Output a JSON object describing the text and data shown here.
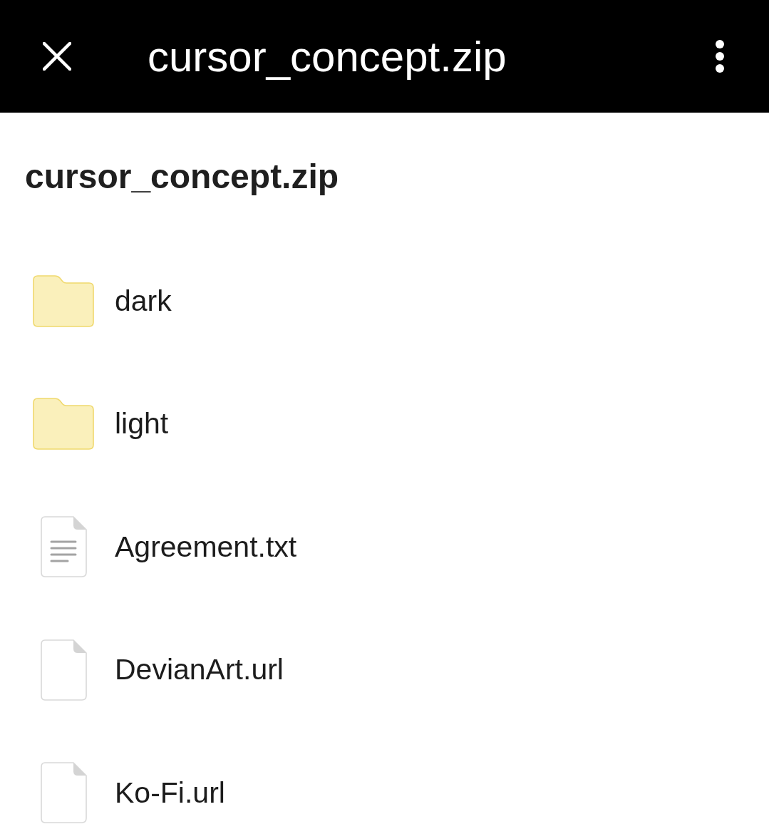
{
  "app_bar": {
    "title": "cursor_concept.zip"
  },
  "heading": "cursor_concept.zip",
  "items": [
    {
      "name": "dark",
      "kind": "folder"
    },
    {
      "name": "light",
      "kind": "folder"
    },
    {
      "name": "Agreement.txt",
      "kind": "text"
    },
    {
      "name": "DevianArt.url",
      "kind": "file"
    },
    {
      "name": "Ko-Fi.url",
      "kind": "file"
    }
  ]
}
